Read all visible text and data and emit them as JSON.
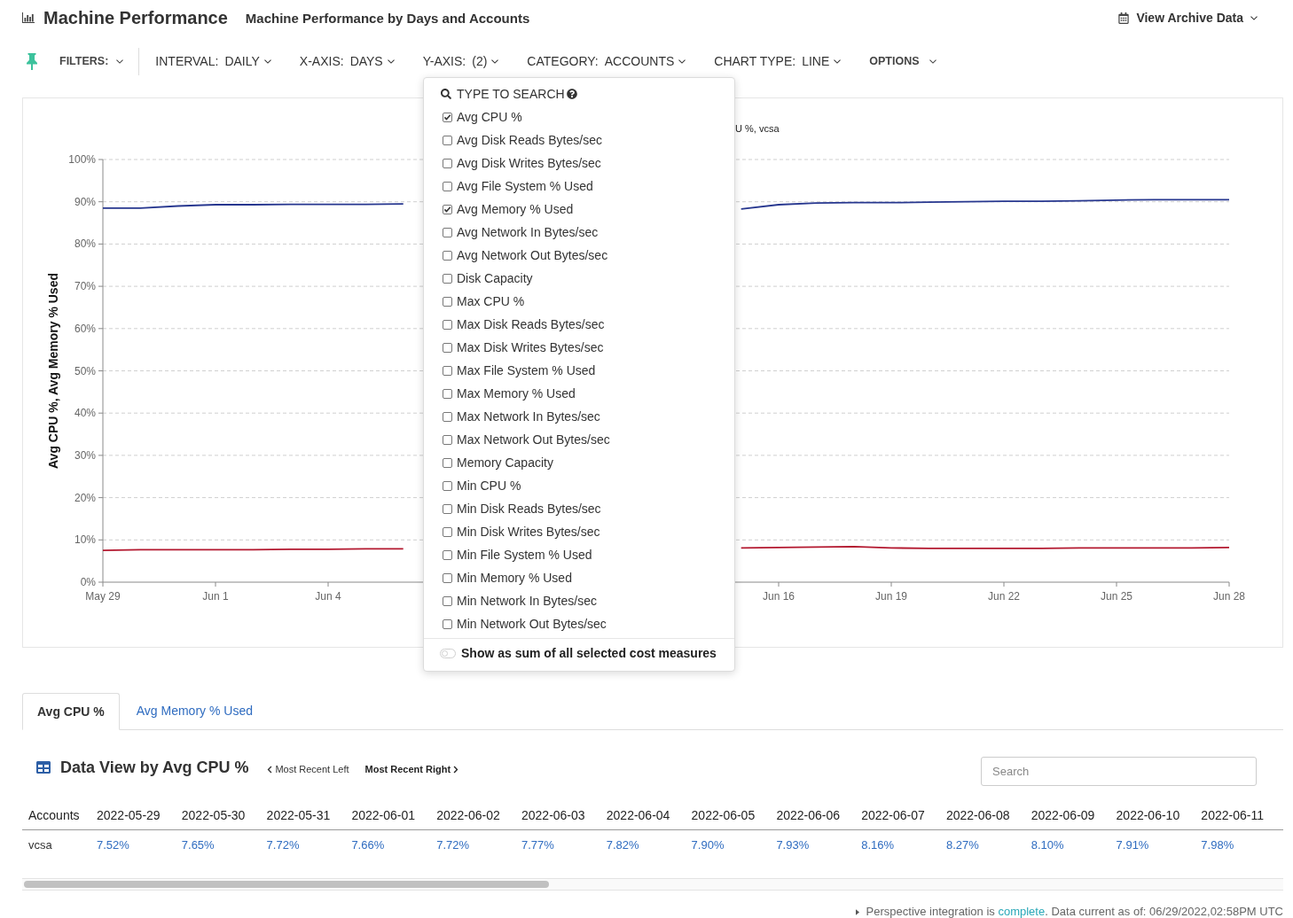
{
  "header": {
    "title": "Machine Performance",
    "subtitle": "Machine Performance by Days and Accounts",
    "archive_button": "View Archive Data"
  },
  "filter_bar": {
    "filters_label": "FILTERS:",
    "controls": [
      {
        "label": "INTERVAL:",
        "value": "DAILY"
      },
      {
        "label": "X-AXIS:",
        "value": "DAYS"
      },
      {
        "label": "Y-AXIS:",
        "value": "(2)"
      },
      {
        "label": "CATEGORY:",
        "value": "ACCOUNTS"
      },
      {
        "label": "CHART TYPE:",
        "value": "LINE"
      }
    ],
    "options_label": "OPTIONS"
  },
  "y_axis_menu": {
    "search": {
      "placeholder": "TYPE TO SEARCH"
    },
    "measures": [
      {
        "label": "Avg CPU %",
        "checked": true
      },
      {
        "label": "Avg Disk Reads Bytes/sec",
        "checked": false
      },
      {
        "label": "Avg Disk Writes Bytes/sec",
        "checked": false
      },
      {
        "label": "Avg File System % Used",
        "checked": false
      },
      {
        "label": "Avg Memory % Used",
        "checked": true
      },
      {
        "label": "Avg Network In Bytes/sec",
        "checked": false
      },
      {
        "label": "Avg Network Out Bytes/sec",
        "checked": false
      },
      {
        "label": "Disk Capacity",
        "checked": false
      },
      {
        "label": "Max CPU %",
        "checked": false
      },
      {
        "label": "Max Disk Reads Bytes/sec",
        "checked": false
      },
      {
        "label": "Max Disk Writes Bytes/sec",
        "checked": false
      },
      {
        "label": "Max File System % Used",
        "checked": false
      },
      {
        "label": "Max Memory % Used",
        "checked": false
      },
      {
        "label": "Max Network In Bytes/sec",
        "checked": false
      },
      {
        "label": "Max Network Out Bytes/sec",
        "checked": false
      },
      {
        "label": "Memory Capacity",
        "checked": false
      },
      {
        "label": "Min CPU %",
        "checked": false
      },
      {
        "label": "Min Disk Reads Bytes/sec",
        "checked": false
      },
      {
        "label": "Min Disk Writes Bytes/sec",
        "checked": false
      },
      {
        "label": "Min File System % Used",
        "checked": false
      },
      {
        "label": "Min Memory % Used",
        "checked": false
      },
      {
        "label": "Min Network In Bytes/sec",
        "checked": false
      },
      {
        "label": "Min Network Out Bytes/sec",
        "checked": false
      }
    ],
    "sum_toggle": {
      "label": "Show as sum of all selected cost measures",
      "on": false
    }
  },
  "chart": {
    "legend": [
      "U %, vcsa"
    ],
    "chart_data": {
      "type": "line",
      "ylabel": "Avg CPU %, Avg Memory % Used",
      "categories": [
        "May 29",
        null,
        null,
        "Jun 1",
        null,
        null,
        "Jun 4",
        null,
        null,
        null,
        null,
        null,
        null,
        null,
        null,
        null,
        null,
        null,
        "Jun 16",
        null,
        null,
        "Jun 19",
        null,
        null,
        "Jun 22",
        null,
        null,
        "Jun 25",
        null,
        null,
        "Jun 28"
      ],
      "ylim": [
        0,
        100
      ],
      "yticks": [
        {
          "value": 0,
          "label": "0%"
        },
        {
          "value": 10,
          "label": "10%"
        },
        {
          "value": 20,
          "label": "20%"
        },
        {
          "value": 30,
          "label": "30%"
        },
        {
          "value": 40,
          "label": "40%"
        },
        {
          "value": 50,
          "label": "50%"
        },
        {
          "value": 60,
          "label": "60%"
        },
        {
          "value": 70,
          "label": "70%"
        },
        {
          "value": 80,
          "label": "80%"
        },
        {
          "value": 90,
          "label": "90%"
        },
        {
          "value": 100,
          "label": "100%"
        }
      ],
      "grid": true,
      "series": [
        {
          "color": "#27378f",
          "values": [
            88.5,
            88.5,
            89.0,
            89.3,
            89.3,
            89.4,
            89.4,
            89.4,
            89.5,
            null,
            null,
            null,
            null,
            null,
            null,
            null,
            null,
            88.3,
            89.3,
            89.7,
            89.8,
            89.8,
            89.9,
            90.0,
            90.1,
            90.1,
            90.2,
            90.4,
            90.5,
            90.5,
            90.5
          ]
        },
        {
          "color": "#b3182f",
          "values": [
            7.5,
            7.7,
            7.7,
            7.7,
            7.7,
            7.8,
            7.8,
            7.9,
            7.9,
            null,
            null,
            null,
            null,
            null,
            null,
            null,
            null,
            8.1,
            8.2,
            8.3,
            8.4,
            8.1,
            8.0,
            8.0,
            8.0,
            8.0,
            8.1,
            8.1,
            8.1,
            8.1,
            8.2
          ]
        }
      ]
    }
  },
  "tabs": [
    {
      "label": "Avg CPU %",
      "selected": true
    },
    {
      "label": "Avg Memory % Used",
      "selected": false
    }
  ],
  "data_view": {
    "title": "Data View by Avg CPU %",
    "order_options": [
      {
        "label": "Most Recent Left",
        "kind": "left",
        "selected": false
      },
      {
        "label": "Most Recent Right",
        "kind": "right",
        "selected": true
      }
    ],
    "search": {
      "placeholder": "Search"
    }
  },
  "table": {
    "columns": [
      "Accounts",
      "2022-05-29",
      "2022-05-30",
      "2022-05-31",
      "2022-06-01",
      "2022-06-02",
      "2022-06-03",
      "2022-06-04",
      "2022-06-05",
      "2022-06-06",
      "2022-06-07",
      "2022-06-08",
      "2022-06-09",
      "2022-06-10",
      "2022-06-11"
    ],
    "rows": [
      [
        "vcsa",
        "7.52%",
        "7.65%",
        "7.72%",
        "7.66%",
        "7.72%",
        "7.77%",
        "7.82%",
        "7.90%",
        "7.93%",
        "8.16%",
        "8.27%",
        "8.10%",
        "7.91%",
        "7.98%"
      ]
    ]
  },
  "status_bar": {
    "text_before": "Perspective integration is ",
    "link": "complete",
    "text_after": ". Data current as of: 06/29/2022,02:58PM UTC"
  }
}
